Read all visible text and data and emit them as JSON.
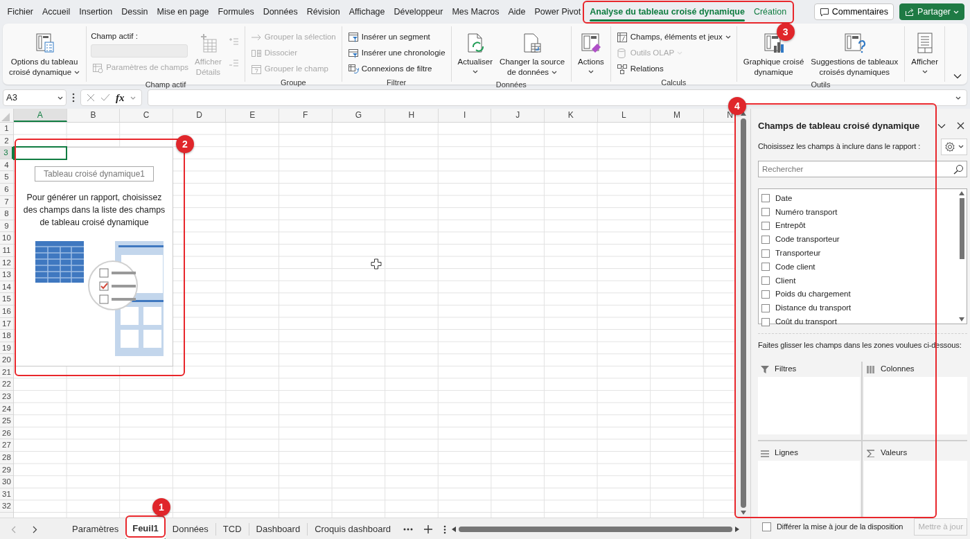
{
  "menu_tabs": [
    {
      "label": "Fichier",
      "selected": false,
      "contextual": false
    },
    {
      "label": "Accueil",
      "selected": false,
      "contextual": false
    },
    {
      "label": "Insertion",
      "selected": false,
      "contextual": false
    },
    {
      "label": "Dessin",
      "selected": false,
      "contextual": false
    },
    {
      "label": "Mise en page",
      "selected": false,
      "contextual": false
    },
    {
      "label": "Formules",
      "selected": false,
      "contextual": false
    },
    {
      "label": "Données",
      "selected": false,
      "contextual": false
    },
    {
      "label": "Révision",
      "selected": false,
      "contextual": false
    },
    {
      "label": "Affichage",
      "selected": false,
      "contextual": false
    },
    {
      "label": "Développeur",
      "selected": false,
      "contextual": false
    },
    {
      "label": "Mes Macros",
      "selected": false,
      "contextual": false
    },
    {
      "label": "Aide",
      "selected": false,
      "contextual": false
    },
    {
      "label": "Power Pivot",
      "selected": false,
      "contextual": false
    },
    {
      "label": "Analyse du tableau croisé dynamique",
      "selected": true,
      "contextual": true
    },
    {
      "label": "Création",
      "selected": false,
      "contextual": true
    }
  ],
  "header_buttons": [
    {
      "kind": "comments",
      "label": "Commentaires"
    },
    {
      "kind": "share",
      "label": "Partager",
      "dropdown": true
    }
  ],
  "ribbon": {
    "groups": [
      {
        "columns": [
          [
            {
              "kind": "large",
              "lines": [
                "Options du tableau",
                "croisé dynamique"
              ],
              "dropdown": true,
              "disabled": false
            }
          ]
        ]
      },
      {
        "label": "Champ actif",
        "columns": [
          [
            {
              "kind": "text",
              "label": "Champ actif :"
            },
            {
              "kind": "field",
              "disabled": true
            },
            {
              "kind": "small",
              "label": "Paramètres de champs",
              "disabled": true
            }
          ],
          [
            {
              "kind": "large",
              "lines": [
                "Afficher",
                "Détails"
              ],
              "dropdown": false,
              "disabled": true
            }
          ],
          [
            {
              "kind": "icon",
              "disabled": true
            },
            {
              "kind": "icon",
              "disabled": true
            }
          ]
        ]
      },
      {
        "label": "Groupe",
        "columns": [
          [
            {
              "kind": "small",
              "label": "Grouper la sélection",
              "disabled": true
            },
            {
              "kind": "small",
              "label": "Dissocier",
              "disabled": true
            },
            {
              "kind": "small",
              "label": "Grouper le champ",
              "disabled": true
            }
          ]
        ]
      },
      {
        "label": "Filtrer",
        "columns": [
          [
            {
              "kind": "small",
              "label": "Insérer un segment",
              "disabled": false
            },
            {
              "kind": "small",
              "label": "Insérer une chronologie",
              "disabled": false
            },
            {
              "kind": "small",
              "label": "Connexions de filtre",
              "disabled": false
            }
          ]
        ]
      },
      {
        "label": "Données",
        "columns": [
          [
            {
              "kind": "large",
              "lines": [
                "Actualiser"
              ],
              "dropdown": true,
              "disabled": false
            }
          ],
          [
            {
              "kind": "large",
              "lines": [
                "Changer la source",
                "de données"
              ],
              "dropdown": true,
              "disabled": false
            }
          ]
        ]
      },
      {
        "columns": [
          [
            {
              "kind": "large",
              "lines": [
                "Actions"
              ],
              "dropdown": true,
              "disabled": false
            }
          ]
        ]
      },
      {
        "label": "Calculs",
        "columns": [
          [
            {
              "kind": "small",
              "label": "Champs, éléments et jeux",
              "dropdown": true,
              "disabled": false
            },
            {
              "kind": "small",
              "label": "Outils OLAP",
              "dropdown": true,
              "disabled": true
            },
            {
              "kind": "small",
              "label": "Relations",
              "disabled": false
            }
          ]
        ]
      },
      {
        "label": "Outils",
        "columns": [
          [
            {
              "kind": "large",
              "lines": [
                "Graphique croisé",
                "dynamique"
              ],
              "dropdown": false,
              "disabled": false
            }
          ],
          [
            {
              "kind": "large",
              "lines": [
                "Suggestions de tableaux",
                "croisés dynamiques"
              ],
              "dropdown": false,
              "disabled": false
            }
          ]
        ]
      },
      {
        "columns": [
          [
            {
              "kind": "large",
              "lines": [
                "Afficher"
              ],
              "dropdown": true,
              "disabled": false
            }
          ]
        ]
      }
    ]
  },
  "formula_bar": {
    "name_box": "A3",
    "fx": "fx"
  },
  "sheet": {
    "columns": [
      {
        "label": "A",
        "selected": true
      },
      {
        "label": "B",
        "selected": false
      },
      {
        "label": "C",
        "selected": false
      },
      {
        "label": "D",
        "selected": false
      },
      {
        "label": "E",
        "selected": false
      },
      {
        "label": "F",
        "selected": false
      },
      {
        "label": "G",
        "selected": false
      },
      {
        "label": "H",
        "selected": false
      },
      {
        "label": "I",
        "selected": false
      },
      {
        "label": "J",
        "selected": false
      },
      {
        "label": "K",
        "selected": false
      },
      {
        "label": "L",
        "selected": false
      },
      {
        "label": "M",
        "selected": false
      },
      {
        "label": "N",
        "selected": false
      }
    ],
    "rows": [
      {
        "label": "1",
        "selected": false
      },
      {
        "label": "2",
        "selected": false
      },
      {
        "label": "3",
        "selected": true
      },
      {
        "label": "4",
        "selected": false
      },
      {
        "label": "5",
        "selected": false
      },
      {
        "label": "6",
        "selected": false
      },
      {
        "label": "7",
        "selected": false
      },
      {
        "label": "8",
        "selected": false
      },
      {
        "label": "9",
        "selected": false
      },
      {
        "label": "10",
        "selected": false
      },
      {
        "label": "11",
        "selected": false
      },
      {
        "label": "12",
        "selected": false
      },
      {
        "label": "13",
        "selected": false
      },
      {
        "label": "14",
        "selected": false
      },
      {
        "label": "15",
        "selected": false
      },
      {
        "label": "16",
        "selected": false
      },
      {
        "label": "17",
        "selected": false
      },
      {
        "label": "18",
        "selected": false
      },
      {
        "label": "19",
        "selected": false
      },
      {
        "label": "20",
        "selected": false
      },
      {
        "label": "21",
        "selected": false
      },
      {
        "label": "22",
        "selected": false
      },
      {
        "label": "23",
        "selected": false
      },
      {
        "label": "24",
        "selected": false
      },
      {
        "label": "25",
        "selected": false
      },
      {
        "label": "26",
        "selected": false
      },
      {
        "label": "27",
        "selected": false
      },
      {
        "label": "28",
        "selected": false
      },
      {
        "label": "29",
        "selected": false
      },
      {
        "label": "30",
        "selected": false
      },
      {
        "label": "31",
        "selected": false
      },
      {
        "label": "32",
        "selected": false
      }
    ]
  },
  "pivot_placeholder": {
    "title": "Tableau croisé dynamique1",
    "message": "Pour générer un rapport, choisissez des champs dans la liste des champs de tableau croisé dynamique"
  },
  "sheet_tabs": [
    {
      "label": "Paramètres",
      "selected": false
    },
    {
      "label": "Feuil1",
      "selected": true
    },
    {
      "label": "Données",
      "selected": false
    },
    {
      "label": "TCD",
      "selected": false
    },
    {
      "label": "Dashboard",
      "selected": false
    },
    {
      "label": "Croquis dashboard",
      "selected": false
    }
  ],
  "pivot_pane": {
    "title": "Champs de tableau croisé dynamique",
    "prompt": "Choisissez les champs à inclure dans le rapport :",
    "search": {
      "placeholder": "Rechercher"
    },
    "fields": [
      {
        "label": "Date",
        "checked": false
      },
      {
        "label": "Numéro transport",
        "checked": false
      },
      {
        "label": "Entrepôt",
        "checked": false
      },
      {
        "label": "Code transporteur",
        "checked": false
      },
      {
        "label": "Transporteur",
        "checked": false
      },
      {
        "label": "Code client",
        "checked": false
      },
      {
        "label": "Client",
        "checked": false
      },
      {
        "label": "Poids du chargement",
        "checked": false
      },
      {
        "label": "Distance du transport",
        "checked": false
      },
      {
        "label": "Coût du transport",
        "checked": false
      }
    ],
    "drag_hint": "Faites glisser les champs dans les zones voulues ci-dessous:",
    "areas": [
      {
        "kind": "filters",
        "label": "Filtres"
      },
      {
        "kind": "columns",
        "label": "Colonnes"
      },
      {
        "kind": "rows",
        "label": "Lignes"
      },
      {
        "kind": "values",
        "label": "Valeurs"
      }
    ],
    "defer": {
      "label": "Différer la mise à jour de la disposition",
      "checked": false
    },
    "update_button": {
      "label": "Mettre à jour",
      "disabled": true
    }
  },
  "annotations": [
    {
      "number": "1"
    },
    {
      "number": "2"
    },
    {
      "number": "3"
    },
    {
      "number": "4"
    }
  ]
}
